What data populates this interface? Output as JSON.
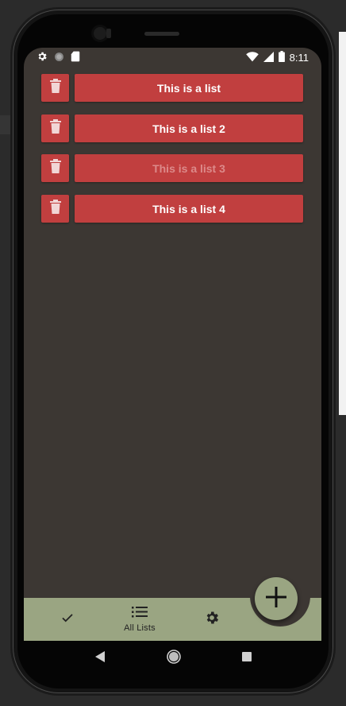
{
  "status_bar": {
    "time": "8:11",
    "left_icons": [
      "gear-icon",
      "circle-icon",
      "sd-card-icon"
    ],
    "right_icons": [
      "wifi-icon",
      "signal-icon",
      "battery-icon"
    ]
  },
  "lists": [
    {
      "label": "This is a list",
      "enabled": true
    },
    {
      "label": "This is a list 2",
      "enabled": true
    },
    {
      "label": "This is a list 3",
      "enabled": false
    },
    {
      "label": "This is a list 4",
      "enabled": true
    }
  ],
  "bottom_nav": {
    "items": [
      {
        "icon": "check-icon",
        "label": ""
      },
      {
        "icon": "list-icon",
        "label": "All Lists"
      },
      {
        "icon": "gear-icon",
        "label": ""
      }
    ]
  },
  "fab": {
    "icon": "plus-icon"
  },
  "colors": {
    "background": "#3c3733",
    "list_button": "#c13f3f",
    "nav_bar": "#9aa582"
  }
}
